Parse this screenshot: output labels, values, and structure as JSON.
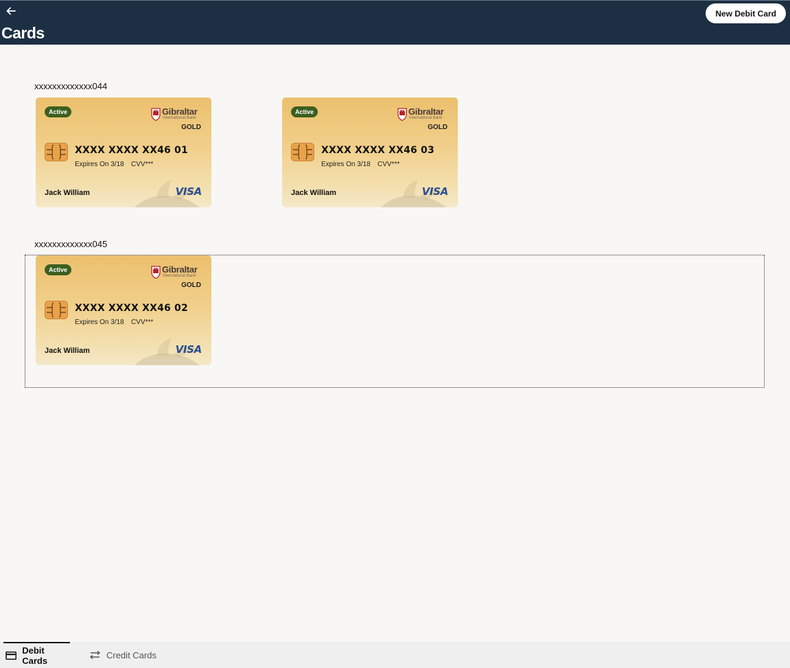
{
  "header": {
    "back_icon": "arrow-left-icon",
    "title": "Cards",
    "new_card_label": "New Debit Card"
  },
  "accounts": [
    {
      "label": "xxxxxxxxxxxxx044",
      "cards": [
        {
          "status": "Active",
          "bank_name": "Gibraltar",
          "bank_sub": "International Bank",
          "tier": "GOLD",
          "number": "XXXX XXXX XX46 01",
          "expiry": "Expires On 3/18",
          "cvv": "CVV***",
          "holder": "Jack William",
          "network": "VISA"
        },
        {
          "status": "Active",
          "bank_name": "Gibraltar",
          "bank_sub": "International Bank",
          "tier": "GOLD",
          "number": "XXXX XXXX XX46 03",
          "expiry": "Expires On 3/18",
          "cvv": "CVV***",
          "holder": "Jack William",
          "network": "VISA"
        }
      ]
    },
    {
      "label": "xxxxxxxxxxxxx045",
      "cards": [
        {
          "status": "Active",
          "bank_name": "Gibraltar",
          "bank_sub": "International Bank",
          "tier": "GOLD",
          "number": "XXXX XXXX XX46 02",
          "expiry": "Expires On 3/18",
          "cvv": "CVV***",
          "holder": "Jack William",
          "network": "VISA"
        }
      ]
    }
  ],
  "tabs": [
    {
      "label": "Debit Cards",
      "icon": "credit-card-icon",
      "active": true
    },
    {
      "label": "Credit Cards",
      "icon": "swap-arrows-icon",
      "active": false
    }
  ],
  "colors": {
    "header_bg": "#1d2f43",
    "page_bg": "#f9f7f5",
    "badge_green": "#3b5f1f",
    "visa_blue": "#2a4d8f",
    "card_gold": "#ebc06d"
  }
}
